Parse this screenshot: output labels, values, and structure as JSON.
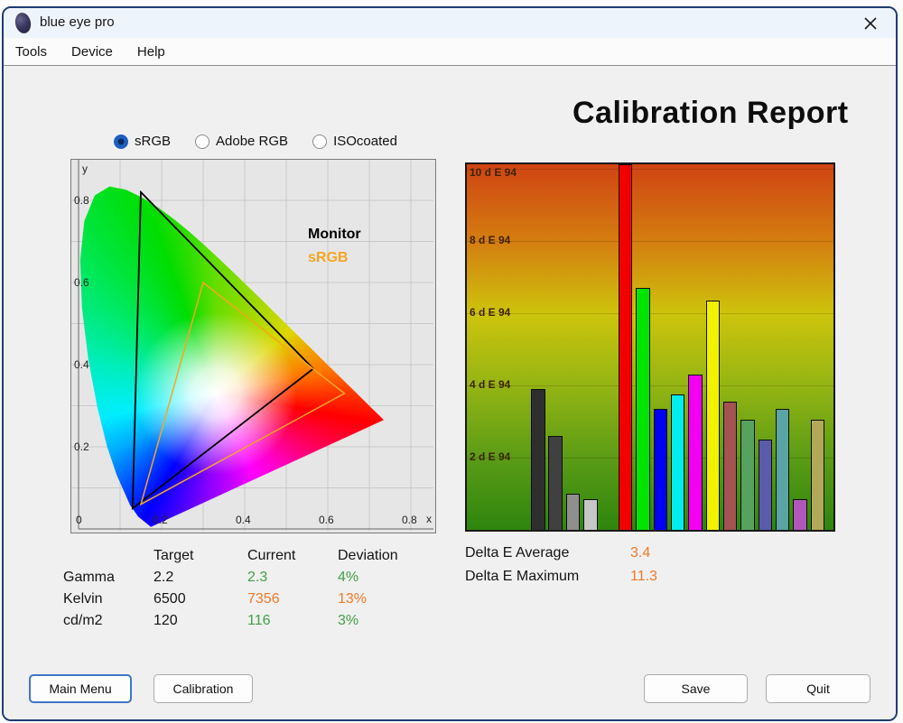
{
  "window": {
    "title": "blue eye pro"
  },
  "menu": {
    "items": [
      {
        "label": "Tools"
      },
      {
        "label": "Device"
      },
      {
        "label": "Help"
      }
    ]
  },
  "profiles": {
    "options": [
      {
        "label": "sRGB",
        "selected": true
      },
      {
        "label": "Adobe RGB",
        "selected": false
      },
      {
        "label": "ISOcoated",
        "selected": false
      }
    ]
  },
  "report": {
    "title": "Calibration Report"
  },
  "colors": {
    "monitor_triangle": "#000000",
    "srgb_triangle": "#f5a623",
    "status_good": "#43a047",
    "status_warn": "#ef7a28"
  },
  "chart_data": [
    {
      "id": "cie_chromaticity_diagram",
      "type": "area",
      "xlabel": "x",
      "ylabel": "y",
      "xlim": [
        0,
        0.85
      ],
      "ylim": [
        0,
        0.9
      ],
      "grid": true,
      "x_ticks": [
        {
          "value": 0.2,
          "label": "0.2"
        },
        {
          "value": 0.4,
          "label": "0.4"
        },
        {
          "value": 0.6,
          "label": "0.6"
        },
        {
          "value": 0.8,
          "label": "0.8"
        }
      ],
      "y_ticks": [
        {
          "value": 0.2,
          "label": "0.2"
        },
        {
          "value": 0.4,
          "label": "0.4"
        },
        {
          "value": 0.6,
          "label": "0.6"
        },
        {
          "value": 0.8,
          "label": "0.8"
        }
      ],
      "origin_label": "0",
      "legend": [
        {
          "name": "Monitor",
          "color": "#000000"
        },
        {
          "name": "sRGB",
          "color": "#f5a623"
        }
      ],
      "series": [
        {
          "name": "Monitor",
          "vertices": [
            [
              0.15,
              0.82
            ],
            [
              0.565,
              0.39
            ],
            [
              0.13,
              0.05
            ]
          ]
        },
        {
          "name": "sRGB",
          "vertices": [
            [
              0.64,
              0.33
            ],
            [
              0.3,
              0.6
            ],
            [
              0.15,
              0.06
            ]
          ]
        }
      ]
    },
    {
      "id": "delta_e_per_patch",
      "type": "bar",
      "ylim": [
        0,
        10.12
      ],
      "grid": true,
      "y_ticks": [
        {
          "value": 10,
          "label": "10 d E 94"
        },
        {
          "value": 8,
          "label": "8 d E 94"
        },
        {
          "value": 6,
          "label": "6 d E 94"
        },
        {
          "value": 4,
          "label": "4 d E 94"
        },
        {
          "value": 2,
          "label": "2 d E 94"
        }
      ],
      "bars": [
        {
          "slot": 0,
          "value": 3.9,
          "color": "#2e2e2e"
        },
        {
          "slot": 1,
          "value": 2.6,
          "color": "#404040"
        },
        {
          "slot": 2,
          "value": 1.0,
          "color": "#8f8f8f"
        },
        {
          "slot": 3,
          "value": 0.85,
          "color": "#c6c6c6"
        },
        {
          "slot": 5,
          "value": 11.3,
          "color": "#f20000"
        },
        {
          "slot": 6,
          "value": 6.7,
          "color": "#00e400"
        },
        {
          "slot": 7,
          "value": 3.35,
          "color": "#0202f2"
        },
        {
          "slot": 8,
          "value": 3.75,
          "color": "#00eef0"
        },
        {
          "slot": 9,
          "value": 4.3,
          "color": "#f200f2"
        },
        {
          "slot": 10,
          "value": 6.35,
          "color": "#f2f200"
        },
        {
          "slot": 11,
          "value": 3.55,
          "color": "#a45252"
        },
        {
          "slot": 12,
          "value": 3.05,
          "color": "#57a25e"
        },
        {
          "slot": 13,
          "value": 2.5,
          "color": "#5b5bac"
        },
        {
          "slot": 14,
          "value": 3.35,
          "color": "#5aa4a6"
        },
        {
          "slot": 15,
          "value": 0.85,
          "color": "#b257ba"
        },
        {
          "slot": 16,
          "value": 3.05,
          "color": "#b2a958"
        }
      ]
    }
  ],
  "results_table": {
    "columns": [
      "Target",
      "Current",
      "Deviation"
    ],
    "rows": [
      {
        "label": "Gamma",
        "target": "2.2",
        "current": "2.3",
        "current_status": "good",
        "deviation": "4%",
        "deviation_status": "good"
      },
      {
        "label": "Kelvin",
        "target": "6500",
        "current": "7356",
        "current_status": "warn",
        "deviation": "13%",
        "deviation_status": "warn"
      },
      {
        "label": "cd/m2",
        "target": "120",
        "current": "116",
        "current_status": "good",
        "deviation": "3%",
        "deviation_status": "good"
      }
    ]
  },
  "delta_e_summary": {
    "rows": [
      {
        "label": "Delta E Average",
        "value": "3.4"
      },
      {
        "label": "Delta E Maximum",
        "value": "11.3"
      }
    ]
  },
  "footer": {
    "buttons": [
      {
        "label": "Main Menu",
        "primary": true
      },
      {
        "label": "Calibration",
        "primary": false
      },
      {
        "label": "Save",
        "primary": false
      },
      {
        "label": "Quit",
        "primary": false
      }
    ]
  }
}
